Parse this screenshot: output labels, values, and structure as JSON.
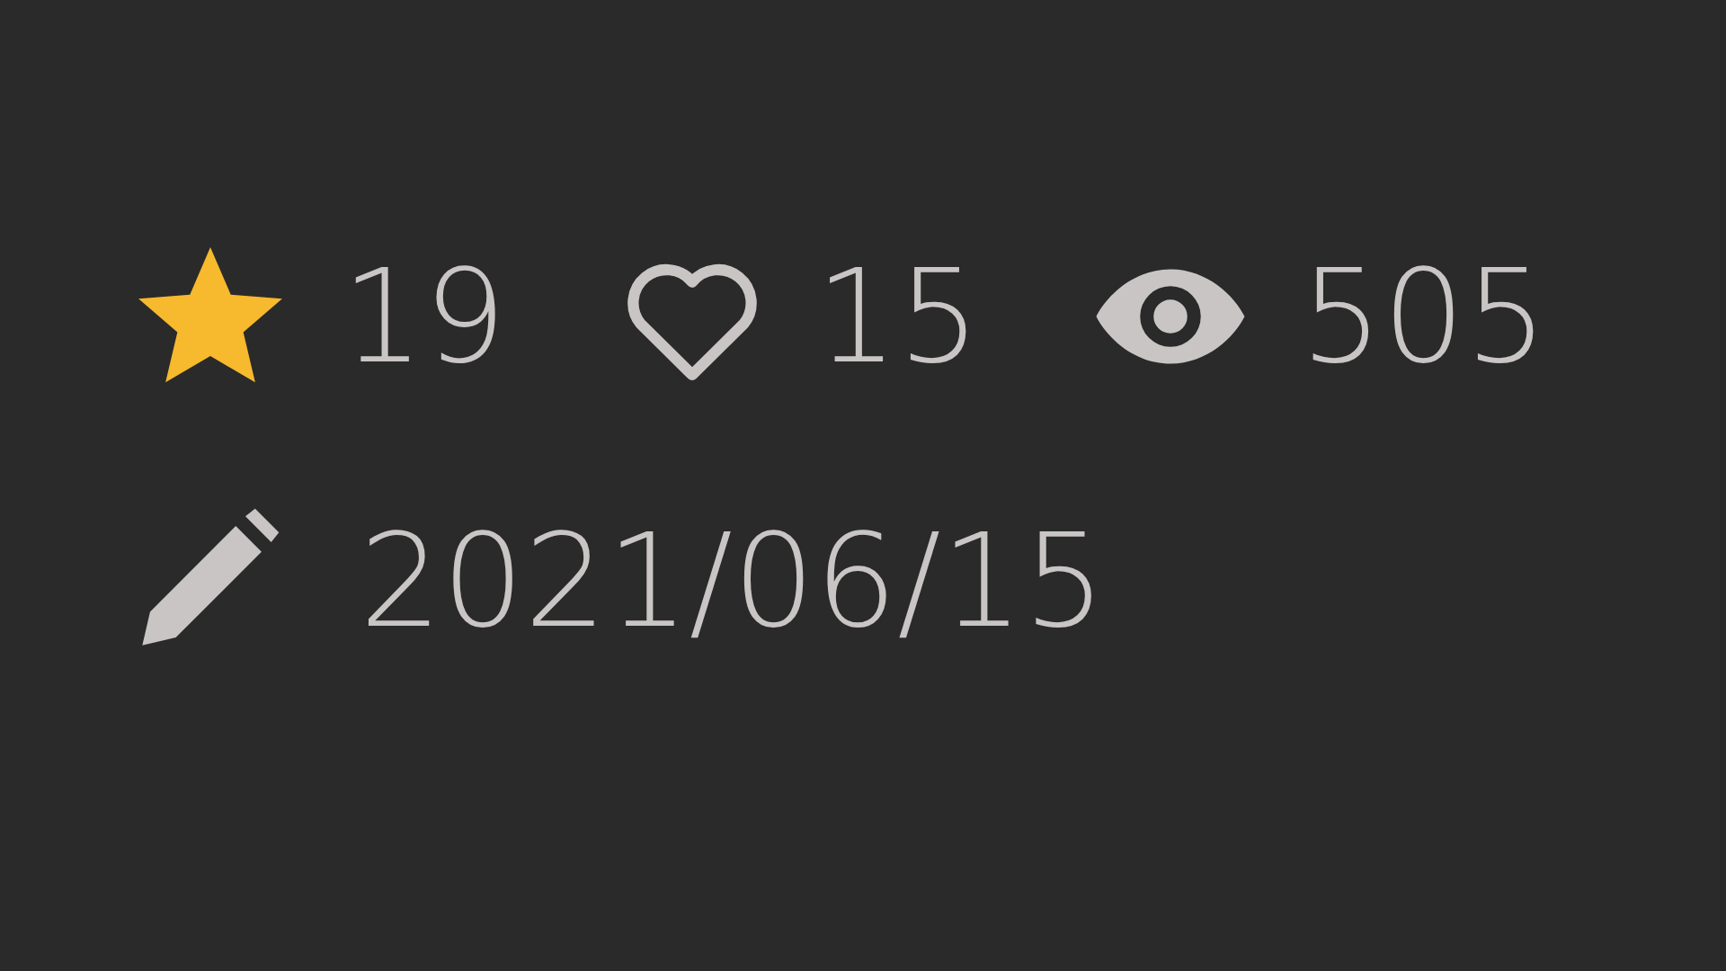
{
  "stats": [
    {
      "kind": "star",
      "count": "19"
    },
    {
      "kind": "heart",
      "count": "15"
    },
    {
      "kind": "eye",
      "count": "505"
    }
  ],
  "edited": {
    "date": "2021/06/15"
  }
}
